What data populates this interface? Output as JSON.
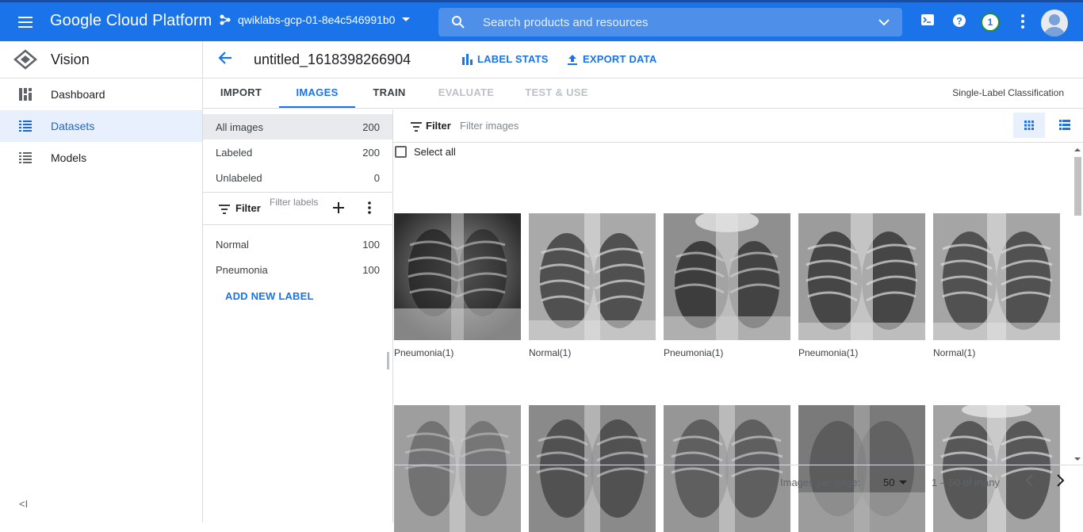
{
  "topbar": {
    "brand": "Google Cloud Platform",
    "project": "qwiklabs-gcp-01-8e4c546991b0",
    "search_placeholder": "Search products and resources",
    "badge": "1"
  },
  "sidebar": {
    "title": "Vision",
    "items": [
      {
        "label": "Dashboard"
      },
      {
        "label": "Datasets"
      },
      {
        "label": "Models"
      }
    ],
    "collapse": "<I"
  },
  "dataset": {
    "name": "untitled_1618398266904",
    "label_stats": "LABEL STATS",
    "export_data": "EXPORT DATA"
  },
  "tabs": [
    {
      "label": "IMPORT"
    },
    {
      "label": "IMAGES"
    },
    {
      "label": "TRAIN"
    },
    {
      "label": "EVALUATE"
    },
    {
      "label": "TEST & USE"
    }
  ],
  "mode": "Single-Label Classification",
  "label_panel": {
    "groups": [
      {
        "name": "All images",
        "count": "200"
      },
      {
        "name": "Labeled",
        "count": "200"
      },
      {
        "name": "Unlabeled",
        "count": "0"
      }
    ],
    "filter_label": "Filter",
    "filter_placeholder": "Filter labels",
    "labels": [
      {
        "name": "Normal",
        "count": "100"
      },
      {
        "name": "Pneumonia",
        "count": "100"
      }
    ],
    "add_new_label": "ADD NEW LABEL"
  },
  "grid": {
    "filter_label": "Filter",
    "filter_placeholder": "Filter images",
    "select_all": "Select all",
    "captions": [
      "Pneumonia(1)",
      "Normal(1)",
      "Pneumonia(1)",
      "Pneumonia(1)",
      "Normal(1)"
    ],
    "per_page_label": "Images per page:",
    "per_page_value": "50",
    "range": "1 – 50 of many"
  }
}
